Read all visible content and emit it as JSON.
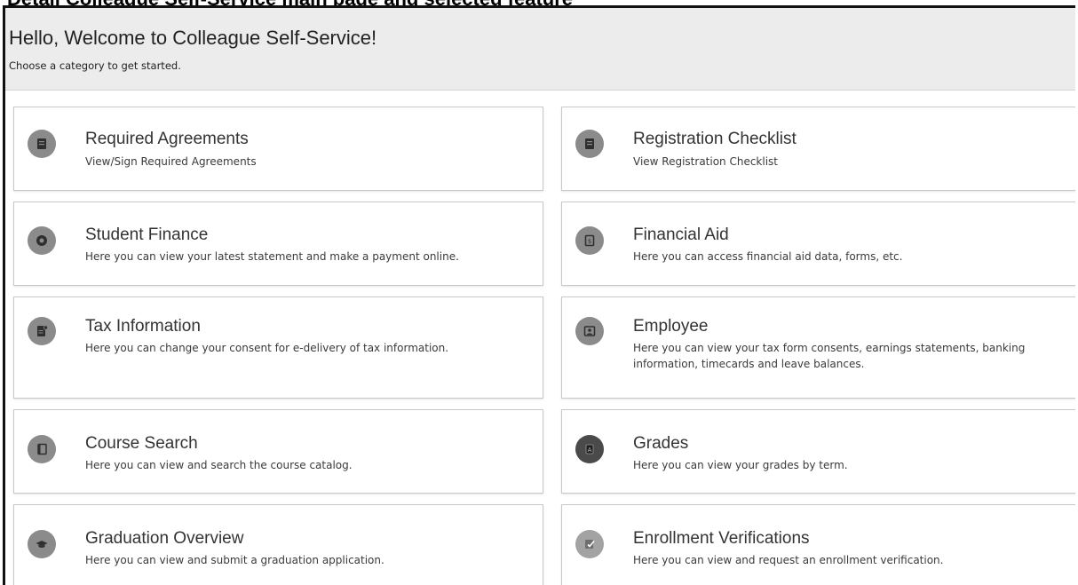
{
  "page": {
    "banner_text": "Detail Colleague Self-Service main page and selected feature"
  },
  "header": {
    "title": "Hello, Welcome to Colleague Self-Service!",
    "subtitle": "Choose a category to get started."
  },
  "tiles": [
    {
      "title": "Required Agreements",
      "description": "View/Sign Required Agreements",
      "icon": "agreement-icon"
    },
    {
      "title": "Registration Checklist",
      "description": "View Registration Checklist",
      "icon": "checklist-icon"
    },
    {
      "title": "Student Finance",
      "description": "Here you can view your latest statement and make a payment online.",
      "icon": "finance-icon"
    },
    {
      "title": "Financial Aid",
      "description": "Here you can access financial aid data, forms, etc.",
      "icon": "financial-aid-icon"
    },
    {
      "title": "Tax Information",
      "description": "Here you can change your consent for e-delivery of tax information.",
      "icon": "tax-document-icon"
    },
    {
      "title": "Employee",
      "description": "Here you can view your tax form consents, earnings statements, banking information, timecards and leave balances.",
      "icon": "employee-badge-icon"
    },
    {
      "title": "Course Search",
      "description": "Here you can view and search the course catalog.",
      "icon": "book-icon"
    },
    {
      "title": "Grades",
      "description": "Here you can view your grades by term.",
      "icon": "grades-icon"
    },
    {
      "title": "Graduation Overview",
      "description": "Here you can view and submit a graduation application.",
      "icon": "graduation-cap-icon"
    },
    {
      "title": "Enrollment Verifications",
      "description": "Here you can view and request an enrollment verification.",
      "icon": "enrollment-verification-icon"
    }
  ]
}
